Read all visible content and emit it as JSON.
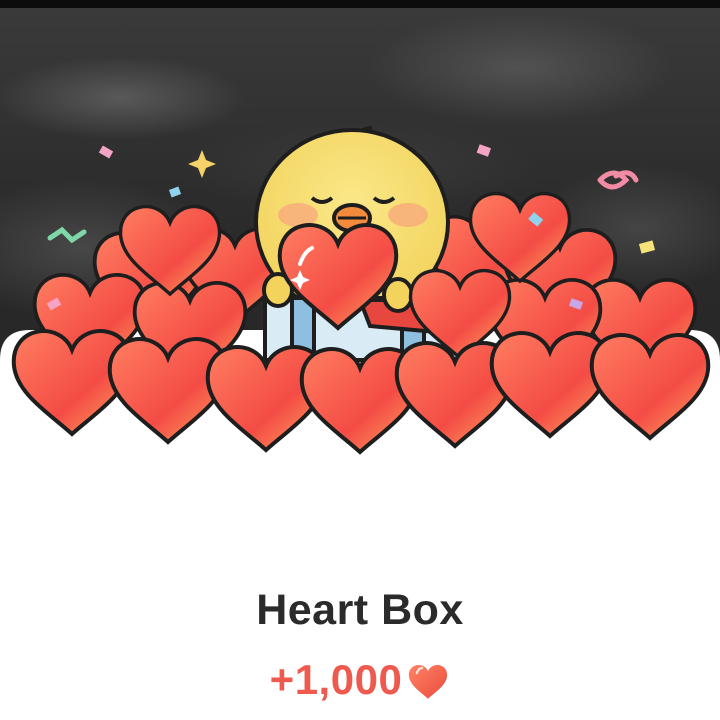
{
  "reward_card": {
    "title": "Heart Box",
    "amount": "+1,000",
    "currency_icon": "heart-icon"
  },
  "colors": {
    "background": "#ffffff",
    "title_text": "#2b2b2b",
    "amount_text": "#ef5a4e",
    "heart_light": "#ff8a5b",
    "heart_dark": "#ee3e3e",
    "heart_outline": "#1e1e1e",
    "chick_body": "#f6dc6e",
    "chick_beak": "#f48b3c"
  }
}
